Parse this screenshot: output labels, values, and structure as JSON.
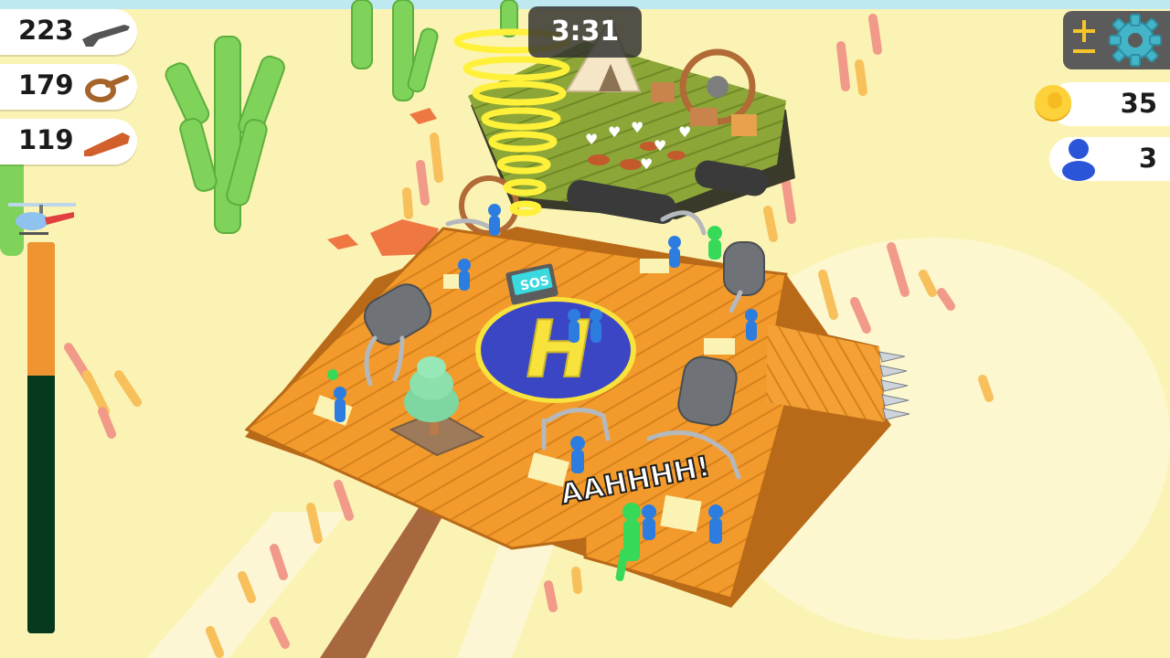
{
  "timer": {
    "text": "3:31"
  },
  "resources": [
    {
      "id": "guns",
      "count": "223",
      "icon": "rifle-icon"
    },
    {
      "id": "rope",
      "count": "179",
      "icon": "rope-icon"
    },
    {
      "id": "wood",
      "count": "119",
      "icon": "wood-plank-icon"
    }
  ],
  "currency": {
    "coins": "35",
    "icon": "coin-icon"
  },
  "people": {
    "count": "3",
    "icon": "person-icon"
  },
  "settings": {
    "icon": "gear-icon",
    "mode_icon": "plus-minus-icon"
  },
  "rescue_progress": {
    "fraction": 0.34,
    "icon": "helicopter-icon"
  },
  "sos_sign": {
    "text": "SOS"
  },
  "helipad": {
    "text": "H"
  },
  "shout": {
    "text": "AAHHHH!"
  },
  "colors": {
    "sand": "#fbf3b4",
    "deck": "#f09a2a",
    "helipad": "#3b46c4",
    "letter": "#f7e33c",
    "progress": "#ef9431",
    "progress_bg": "#07391e"
  }
}
